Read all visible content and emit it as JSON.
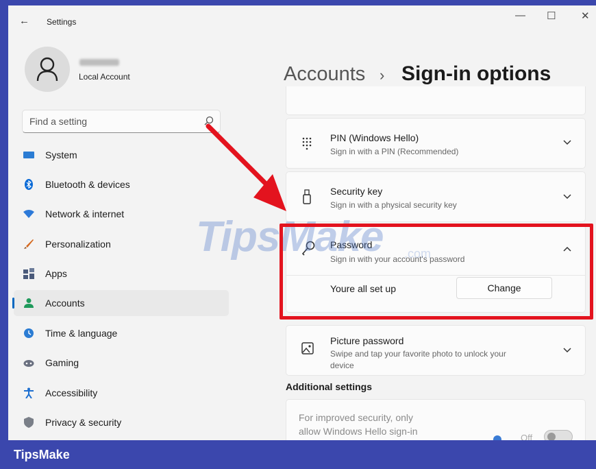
{
  "window": {
    "back_glyph": "←",
    "title": "Settings",
    "minimize_glyph": "—",
    "maximize_glyph": "☐",
    "close_glyph": "✕"
  },
  "profile": {
    "account_type": "Local Account"
  },
  "search": {
    "placeholder": "Find a setting"
  },
  "sidebar": {
    "items": [
      {
        "label": "System",
        "icon": "system-icon",
        "color": "#2b7cd3"
      },
      {
        "label": "Bluetooth & devices",
        "icon": "bluetooth-icon",
        "color": "#0a6ad6"
      },
      {
        "label": "Network & internet",
        "icon": "network-icon",
        "color": "#2c79d8"
      },
      {
        "label": "Personalization",
        "icon": "brush-icon",
        "color": "#d5691f"
      },
      {
        "label": "Apps",
        "icon": "apps-icon",
        "color": "#4a5a7a"
      },
      {
        "label": "Accounts",
        "icon": "accounts-icon",
        "color": "#1f9a5b"
      },
      {
        "label": "Time & language",
        "icon": "globe-clock-icon",
        "color": "#2b7cd3"
      },
      {
        "label": "Gaming",
        "icon": "gamepad-icon",
        "color": "#6a7080"
      },
      {
        "label": "Accessibility",
        "icon": "accessibility-icon",
        "color": "#1d6fd0"
      },
      {
        "label": "Privacy & security",
        "icon": "shield-icon",
        "color": "#7a7f88"
      }
    ],
    "active_index": 5
  },
  "breadcrumb": {
    "parent": "Accounts",
    "separator": "›",
    "current": "Sign-in options"
  },
  "cards": {
    "pin": {
      "title": "PIN (Windows Hello)",
      "subtitle": "Sign in with a PIN (Recommended)",
      "icon": "keypad-icon",
      "expanded": false
    },
    "security_key": {
      "title": "Security key",
      "subtitle": "Sign in with a physical security key",
      "icon": "usb-key-icon",
      "expanded": false
    },
    "password": {
      "title": "Password",
      "subtitle": "Sign in with your account's password",
      "icon": "key-icon",
      "expanded": true,
      "status_text": "Youre all set up",
      "button_label": "Change"
    },
    "picture_password": {
      "title": "Picture password",
      "subtitle_line1": "Swipe and tap your favorite photo to unlock your",
      "subtitle_line2": "device",
      "icon": "picture-icon",
      "expanded": false
    }
  },
  "additional": {
    "heading": "Additional settings",
    "text_line1": "For improved security, only",
    "text_line2": "allow Windows Hello sign-in",
    "toggle_state": "Off"
  },
  "annotation": {
    "arrow_color": "#e3131e",
    "highlight_color": "#e3131e"
  },
  "watermark": {
    "brand": "TipsMake",
    "domain": ".com"
  },
  "footer": {
    "brand": "TipsMake"
  }
}
